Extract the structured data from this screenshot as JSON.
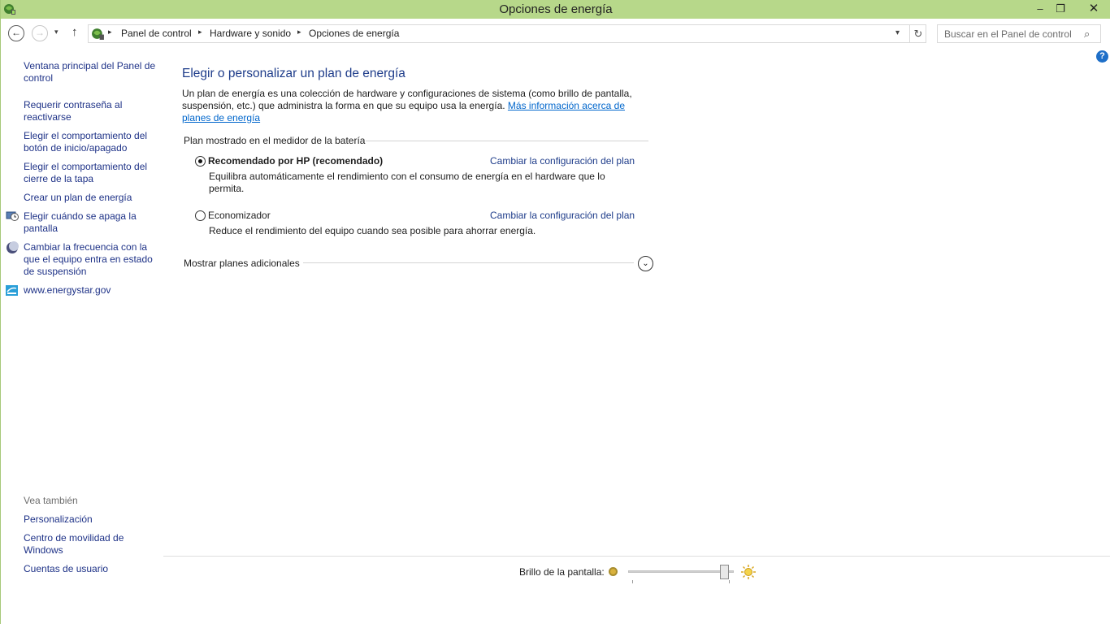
{
  "window": {
    "title": "Opciones de energía",
    "minimize": "–",
    "maximize": "❐",
    "close": "✕"
  },
  "nav": {
    "back": "←",
    "forward": "→",
    "recent": "▾",
    "up": "↑",
    "breadcrumbs": [
      "Panel de control",
      "Hardware y sonido",
      "Opciones de energía"
    ],
    "separator": "▸",
    "dropdown": "▾",
    "refresh": "↻",
    "search_placeholder": "Buscar en el Panel de control",
    "search_icon": "⌕"
  },
  "help": "?",
  "left_pane": {
    "links": [
      "Ventana principal del Panel de control",
      "Requerir contraseña al reactivarse",
      "Elegir el comportamiento del botón de inicio/apagado",
      "Elegir el comportamiento del cierre de la tapa",
      "Crear un plan de energía",
      "Elegir cuándo se apaga la pantalla",
      "Cambiar la frecuencia con la que el equipo entra en estado de suspensión",
      "www.energystar.gov"
    ],
    "see_also_header": "Vea también",
    "see_also": [
      "Personalización",
      "Centro de movilidad de Windows",
      "Cuentas de usuario"
    ]
  },
  "main": {
    "heading": "Elegir o personalizar un plan de energía",
    "intro_text": "Un plan de energía es una colección de hardware y configuraciones de sistema (como brillo de pantalla, suspensión, etc.) que administra la forma en que su equipo usa la energía. ",
    "intro_link": "Más información acerca de planes de energía",
    "group_header": "Plan mostrado en el medidor de la batería",
    "plans": [
      {
        "name": "Recomendado por HP (recomendado)",
        "description": "Equilibra automáticamente el rendimiento con el consumo de energía en el hardware que lo permita.",
        "link": "Cambiar la configuración del plan",
        "selected": true
      },
      {
        "name": "Economizador",
        "description": "Reduce el rendimiento del equipo cuando sea posible para ahorrar energía.",
        "link": "Cambiar la configuración del plan",
        "selected": false
      }
    ],
    "more_plans": "Mostrar planes adicionales",
    "expander": "⌄"
  },
  "brightness": {
    "label": "Brillo de la pantalla:",
    "level_percent": 95
  },
  "colors": {
    "titlebar": "#b7d88a",
    "link": "#1e3287",
    "heading": "#1e3c8a"
  }
}
